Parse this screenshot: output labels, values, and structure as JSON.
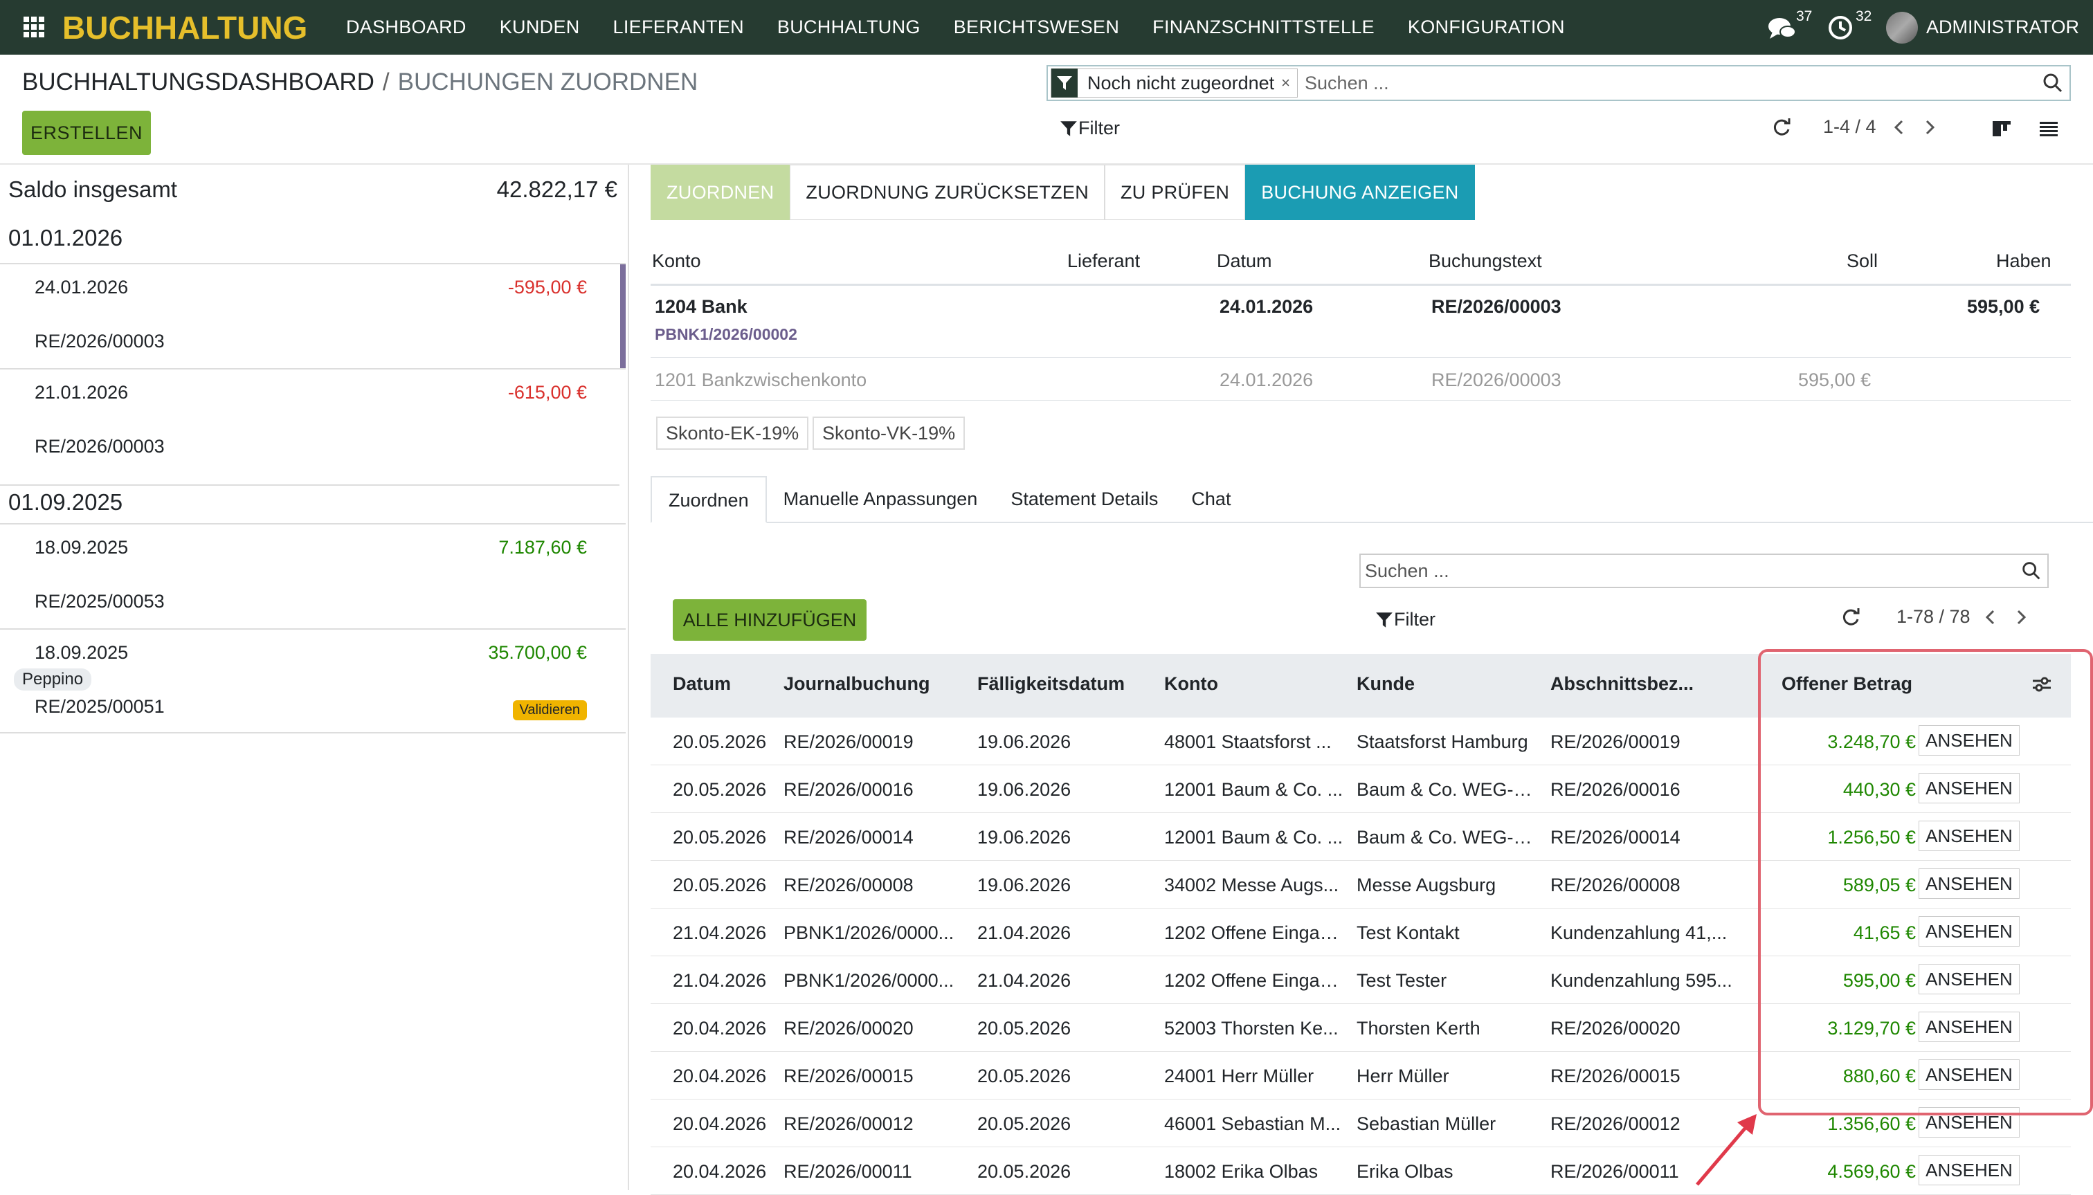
{
  "nav": {
    "brand": "BUCHHALTUNG",
    "menu": [
      "DASHBOARD",
      "KUNDEN",
      "LIEFERANTEN",
      "BUCHHALTUNG",
      "BERICHTSWESEN",
      "FINANZSCHNITTSTELLE",
      "KONFIGURATION"
    ],
    "messages_count": "37",
    "activities_count": "32",
    "user": "ADMINISTRATOR"
  },
  "control": {
    "breadcrumb_root": "BUCHHALTUNGSDASHBOARD",
    "breadcrumb_sep": "/",
    "breadcrumb_current": "BUCHUNGEN ZUORDNEN",
    "facet": "Noch nicht zugeordnet",
    "facet_remove": "×",
    "search_placeholder": "Suchen ...",
    "create": "ERSTELLEN",
    "filter": "Filter",
    "pager": "1-4 / 4"
  },
  "left": {
    "saldo_label": "Saldo insgesamt",
    "saldo_value": "42.822,17 €",
    "groups": [
      {
        "date": "01.01.2026",
        "lines": [
          {
            "date": "24.01.2026",
            "amount": "-595,00 €",
            "ref": "RE/2026/00003"
          },
          {
            "date": "21.01.2026",
            "amount": "-615,00 €",
            "ref": "RE/2026/00003"
          }
        ]
      },
      {
        "date": "01.09.2025",
        "lines": [
          {
            "date": "18.09.2025",
            "amount": "7.187,60 €",
            "ref": "RE/2025/00053"
          },
          {
            "date": "18.09.2025",
            "amount": "35.700,00 €",
            "ref": "RE/2025/00051",
            "partner": "Peppino",
            "badge": "Validieren"
          }
        ]
      }
    ]
  },
  "actions": [
    "ZUORDNEN",
    "ZUORDNUNG ZURÜCKSETZEN",
    "ZU PRÜFEN",
    "BUCHUNG ANZEIGEN"
  ],
  "entry": {
    "headers": {
      "konto": "Konto",
      "lieferant": "Lieferant",
      "datum": "Datum",
      "text": "Buchungstext",
      "soll": "Soll",
      "haben": "Haben"
    },
    "row1": {
      "konto": "1204 Bank",
      "move": "PBNK1/2026/00002",
      "datum": "24.01.2026",
      "text": "RE/2026/00003",
      "haben": "595,00 €"
    },
    "row2": {
      "konto": "1201 Bankzwischenkonto",
      "datum": "24.01.2026",
      "text": "RE/2026/00003",
      "soll": "595,00 €"
    },
    "tags": [
      "Skonto-EK-19%",
      "Skonto-VK-19%"
    ]
  },
  "tabs": [
    "Zuordnen",
    "Manuelle Anpassungen",
    "Statement Details",
    "Chat"
  ],
  "match": {
    "search_placeholder": "Suchen ...",
    "add_all": "ALLE HINZUFÜGEN",
    "filter": "Filter",
    "pager": "1-78 / 78",
    "columns": [
      "Datum",
      "Journalbuchung",
      "Fälligkeitsdatum",
      "Konto",
      "Kunde",
      "Abschnittsbez...",
      "Offener Betrag"
    ],
    "view_label": "ANSEHEN",
    "rows": [
      [
        "20.05.2026",
        "RE/2026/00019",
        "19.06.2026",
        "48001 Staatsforst ...",
        "Staatsforst Hamburg",
        "RE/2026/00019",
        "3.248,70 €"
      ],
      [
        "20.05.2026",
        "RE/2026/00016",
        "19.06.2026",
        "12001 Baum & Co. ...",
        "Baum & Co. WEG-S...",
        "RE/2026/00016",
        "440,30 €"
      ],
      [
        "20.05.2026",
        "RE/2026/00014",
        "19.06.2026",
        "12001 Baum & Co. ...",
        "Baum & Co. WEG-S...",
        "RE/2026/00014",
        "1.256,50 €"
      ],
      [
        "20.05.2026",
        "RE/2026/00008",
        "19.06.2026",
        "34002 Messe Augs...",
        "Messe Augsburg",
        "RE/2026/00008",
        "589,05 €"
      ],
      [
        "21.04.2026",
        "PBNK1/2026/0000...",
        "21.04.2026",
        "1202 Offene Eingan...",
        "Test Kontakt",
        "Kundenzahlung 41,...",
        "41,65 €"
      ],
      [
        "21.04.2026",
        "PBNK1/2026/0000...",
        "21.04.2026",
        "1202 Offene Eingan...",
        "Test Tester",
        "Kundenzahlung 595...",
        "595,00 €"
      ],
      [
        "20.04.2026",
        "RE/2026/00020",
        "20.05.2026",
        "52003 Thorsten Ke...",
        "Thorsten Kerth",
        "RE/2026/00020",
        "3.129,70 €"
      ],
      [
        "20.04.2026",
        "RE/2026/00015",
        "20.05.2026",
        "24001 Herr Müller",
        "Herr Müller",
        "RE/2026/00015",
        "880,60 €"
      ],
      [
        "20.04.2026",
        "RE/2026/00012",
        "20.05.2026",
        "46001 Sebastian M...",
        "Sebastian Müller",
        "RE/2026/00012",
        "1.356,60 €"
      ],
      [
        "20.04.2026",
        "RE/2026/00011",
        "20.05.2026",
        "18002 Erika Olbas",
        "Erika Olbas",
        "RE/2026/00011",
        "4.569,60 €"
      ]
    ]
  },
  "colors": {
    "nav_bg": "#263b31",
    "brand": "#e6bf2b",
    "primary": "#7db33a",
    "info": "#1b9cb3",
    "positive": "#1e8700",
    "negative": "#d9302c",
    "highlight": "#e06470"
  }
}
